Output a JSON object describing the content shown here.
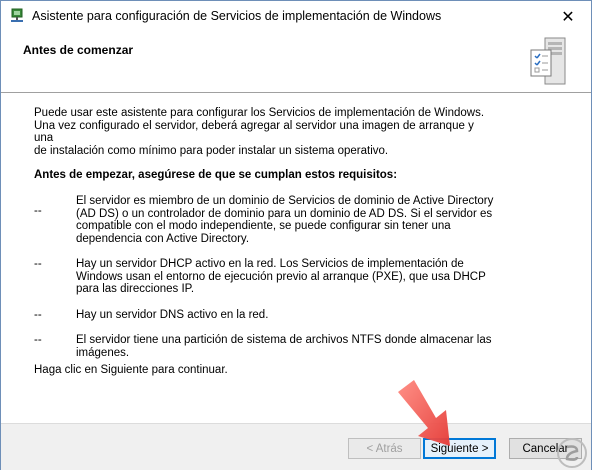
{
  "window": {
    "title": "Asistente para configuración de Servicios de implementación de Windows",
    "close_glyph": "✕"
  },
  "header": {
    "title": "Antes de comenzar"
  },
  "content": {
    "intro_lines": [
      "Puede usar este asistente para configurar los Servicios de implementación de Windows.",
      "Una vez configurado el servidor, deberá agregar al servidor una imagen de arranque y una",
      "de instalación como mínimo para poder instalar un sistema operativo."
    ],
    "requirements_heading": "Antes de empezar, asegúrese de que se cumplan estos requisitos:",
    "requirements": [
      {
        "dash": "--",
        "lines": [
          "El servidor es miembro de un dominio de Servicios de dominio de Active Directory",
          "(AD DS) o un controlador de dominio para un dominio de AD DS. Si el servidor es",
          "compatible con el modo independiente, se puede configurar sin tener una",
          "dependencia con Active Directory."
        ]
      },
      {
        "dash": "--",
        "lines": [
          "Hay un servidor DHCP activo en la red. Los Servicios de implementación de",
          "Windows usan el entorno de ejecución previo al arranque (PXE), que usa DHCP",
          "para las direcciones IP."
        ]
      },
      {
        "dash": "--",
        "lines": [
          "Hay un servidor DNS activo en la red."
        ]
      },
      {
        "dash": "--",
        "lines": [
          "El servidor tiene una partición de sistema de archivos NTFS donde almacenar las",
          "imágenes."
        ]
      }
    ],
    "footer": "Haga clic en Siguiente para continuar."
  },
  "buttons": {
    "back": "< Atrás",
    "next": "Siguiente >",
    "cancel": "Cancelar"
  },
  "colors": {
    "accent": "#0078d7",
    "arrow": "#f05a5a"
  }
}
